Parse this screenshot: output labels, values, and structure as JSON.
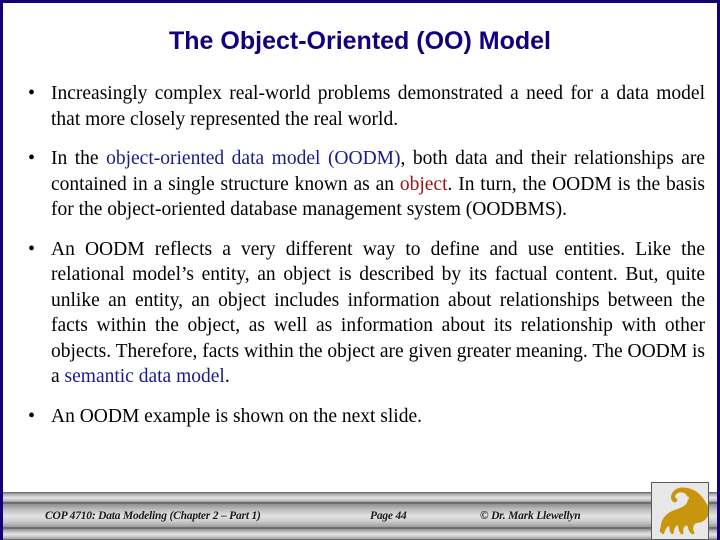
{
  "slide": {
    "title": "The Object-Oriented (OO) Model",
    "colors": {
      "title": "#13007C",
      "border": "#13007C",
      "highlight_blue": "#1A1A8C",
      "highlight_red": "#9B1212",
      "logo_gold": "#C8960C",
      "footer_band": "#c9c9c9"
    },
    "bullet_glyph": "•",
    "bullets": [
      {
        "id": "bullet-1",
        "segments": [
          {
            "text": "Increasingly complex real-world problems demonstrated a need for a data model that more closely represented the real world.",
            "style": "plain"
          }
        ]
      },
      {
        "id": "bullet-2",
        "segments": [
          {
            "text": "In the ",
            "style": "plain"
          },
          {
            "text": "object-oriented data model",
            "style": "blue"
          },
          {
            "text": " ",
            "style": "plain"
          },
          {
            "text": "(OODM)",
            "style": "blue"
          },
          {
            "text": ", both data and their relationships are contained in a single structure known as an ",
            "style": "plain"
          },
          {
            "text": "object",
            "style": "red"
          },
          {
            "text": ".  In turn, the OODM is the basis for the object-oriented database management system (OODBMS).",
            "style": "plain"
          }
        ]
      },
      {
        "id": "bullet-3",
        "segments": [
          {
            "text": "An OODM reflects a very different way to define and use entities.  Like the relational model’s entity, an object is described by its factual content.  But, quite unlike an entity, an object includes information about relationships between the facts within the object, as well as information about its relationship with other objects.   Therefore, facts within the object are given greater meaning.  The OODM is a ",
            "style": "plain"
          },
          {
            "text": "semantic data model",
            "style": "blue"
          },
          {
            "text": ".",
            "style": "plain"
          }
        ]
      },
      {
        "id": "bullet-4",
        "segments": [
          {
            "text": "An OODM example is shown on the next slide.",
            "style": "plain"
          }
        ]
      }
    ]
  },
  "footer": {
    "course": "COP 4710: Data Modeling (Chapter 2 – Part 1)",
    "page": "Page 44",
    "copyright": "© Dr. Mark Llewellyn",
    "logo_name": "ucf-pegasus-logo"
  }
}
